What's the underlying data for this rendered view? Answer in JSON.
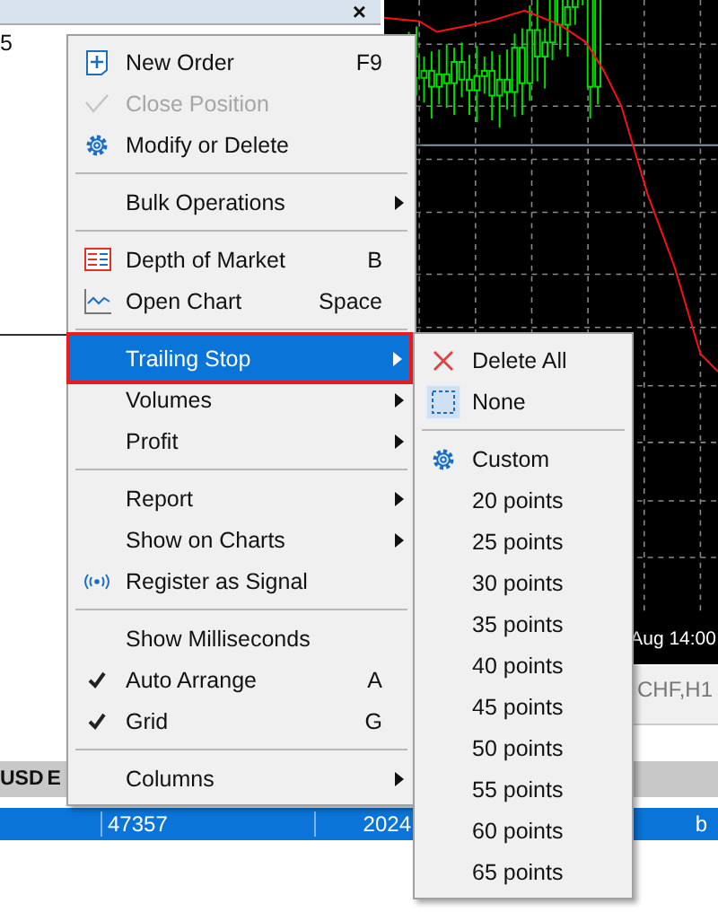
{
  "left_panel": {
    "close_glyph": "×",
    "fragment": "5"
  },
  "chart": {
    "time_label": "Aug 14:00",
    "tab_label": "CHF,H1"
  },
  "table": {
    "header": [
      "USD",
      "E"
    ],
    "selected_row": {
      "selected": true,
      "cells": [
        "47357",
        "2024",
        "b"
      ]
    }
  },
  "context_menu": {
    "items": [
      {
        "kind": "item",
        "label": "New Order",
        "shortcut": "F9",
        "submenu": false,
        "disabled": false,
        "checked": false,
        "selected": false
      },
      {
        "kind": "item",
        "label": "Close Position",
        "submenu": false,
        "disabled": true,
        "checked": false,
        "selected": false
      },
      {
        "kind": "item",
        "label": "Modify or Delete",
        "submenu": false,
        "disabled": false,
        "checked": false,
        "selected": false
      },
      {
        "kind": "separator"
      },
      {
        "kind": "item",
        "label": "Bulk Operations",
        "submenu": true,
        "disabled": false,
        "checked": false,
        "selected": false
      },
      {
        "kind": "separator"
      },
      {
        "kind": "item",
        "label": "Depth of Market",
        "shortcut": "B",
        "submenu": false,
        "disabled": false,
        "checked": false,
        "selected": false
      },
      {
        "kind": "item",
        "label": "Open Chart",
        "shortcut": "Space",
        "submenu": false,
        "disabled": false,
        "checked": false,
        "selected": false
      },
      {
        "kind": "separator"
      },
      {
        "kind": "item",
        "label": "Trailing Stop",
        "submenu": true,
        "disabled": false,
        "checked": false,
        "selected": true
      },
      {
        "kind": "item",
        "label": "Volumes",
        "submenu": true,
        "disabled": false,
        "checked": false,
        "selected": false
      },
      {
        "kind": "item",
        "label": "Profit",
        "submenu": true,
        "disabled": false,
        "checked": false,
        "selected": false
      },
      {
        "kind": "separator"
      },
      {
        "kind": "item",
        "label": "Report",
        "submenu": true,
        "disabled": false,
        "checked": false,
        "selected": false
      },
      {
        "kind": "item",
        "label": "Show on Charts",
        "submenu": true,
        "disabled": false,
        "checked": false,
        "selected": false
      },
      {
        "kind": "item",
        "label": "Register as Signal",
        "submenu": false,
        "disabled": false,
        "checked": false,
        "selected": false
      },
      {
        "kind": "separator"
      },
      {
        "kind": "item",
        "label": "Show Milliseconds",
        "submenu": false,
        "disabled": false,
        "checked": false,
        "selected": false
      },
      {
        "kind": "item",
        "label": "Auto Arrange",
        "shortcut": "A",
        "submenu": false,
        "disabled": false,
        "checked": true,
        "selected": false
      },
      {
        "kind": "item",
        "label": "Grid",
        "shortcut": "G",
        "submenu": false,
        "disabled": false,
        "checked": true,
        "selected": false
      },
      {
        "kind": "separator"
      },
      {
        "kind": "item",
        "label": "Columns",
        "submenu": true,
        "disabled": false,
        "checked": false,
        "selected": false
      }
    ]
  },
  "trailing_stop_submenu": {
    "items": [
      {
        "kind": "item",
        "label": "Delete All",
        "checked": false
      },
      {
        "kind": "item",
        "label": "None",
        "checked": true
      },
      {
        "kind": "separator"
      },
      {
        "kind": "item",
        "label": "Custom",
        "checked": false
      },
      {
        "kind": "item",
        "label": "20 points",
        "checked": false
      },
      {
        "kind": "item",
        "label": "25 points",
        "checked": false
      },
      {
        "kind": "item",
        "label": "30 points",
        "checked": false
      },
      {
        "kind": "item",
        "label": "35 points",
        "checked": false
      },
      {
        "kind": "item",
        "label": "40 points",
        "checked": false
      },
      {
        "kind": "item",
        "label": "45 points",
        "checked": false
      },
      {
        "kind": "item",
        "label": "50 points",
        "checked": false
      },
      {
        "kind": "item",
        "label": "55 points",
        "checked": false
      },
      {
        "kind": "item",
        "label": "60 points",
        "checked": false
      },
      {
        "kind": "item",
        "label": "65 points",
        "checked": false
      }
    ]
  }
}
